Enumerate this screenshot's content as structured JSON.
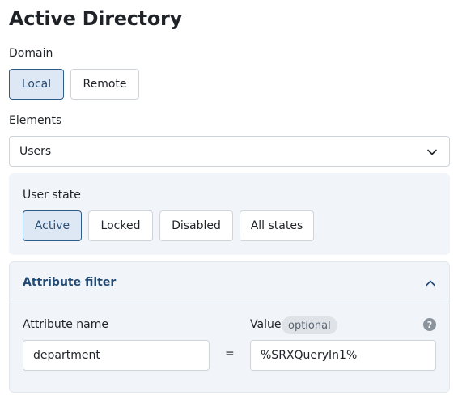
{
  "page": {
    "title": "Active Directory"
  },
  "domain": {
    "label": "Domain",
    "options": [
      "Local",
      "Remote"
    ],
    "selected": "Local"
  },
  "elements": {
    "label": "Elements",
    "value": "Users"
  },
  "user_state": {
    "label": "User state",
    "options": [
      "Active",
      "Locked",
      "Disabled",
      "All states"
    ],
    "selected": "Active"
  },
  "attribute_filter": {
    "title": "Attribute filter",
    "expanded": true,
    "name_label": "Attribute name",
    "name_value": "department",
    "operator": "=",
    "value_label": "Value",
    "value_badge": "optional",
    "value_value": "%SRXQueryIn1%",
    "help_glyph": "?"
  },
  "icons": {
    "elements_dropdown": "chevron-down-icon",
    "attribute_filter_toggle": "chevron-up-icon",
    "value_help": "help-icon"
  },
  "colors": {
    "accent": "#2f5d8a",
    "selected_bg": "#dde8f4",
    "panel_bg": "#f1f4f8",
    "section_title": "#234a72"
  }
}
